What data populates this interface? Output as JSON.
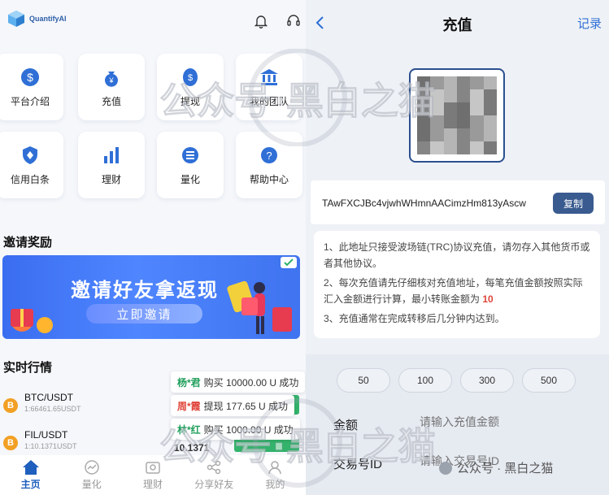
{
  "app": {
    "logo_text": "QuantifyAI"
  },
  "header_icons": [
    "bell-icon",
    "headset-icon"
  ],
  "grid": [
    {
      "label": "平台介绍",
      "icon": "dollar-globe-icon"
    },
    {
      "label": "充值",
      "icon": "money-bag-icon"
    },
    {
      "label": "提现",
      "icon": "coin-icon"
    },
    {
      "label": "我的团队",
      "icon": "bank-icon"
    },
    {
      "label": "信用白条",
      "icon": "shield-icon"
    },
    {
      "label": "理财",
      "icon": "bar-chart-icon"
    },
    {
      "label": "量化",
      "icon": "coin-stack-icon"
    },
    {
      "label": "帮助中心",
      "icon": "help-icon"
    }
  ],
  "invite": {
    "title": "邀请奖励",
    "banner_text": "邀请好友拿返现",
    "button": "立即邀请"
  },
  "market": {
    "title": "实时行情",
    "rows": [
      {
        "pair": "BTC/USDT",
        "volume": "1:66461.65USDT",
        "symbol": "B"
      },
      {
        "pair": "FIL/USDT",
        "volume": "1:10.1371USDT",
        "symbol": "B",
        "price": "10.1371"
      }
    ]
  },
  "toasts": [
    {
      "name": "杨*君",
      "text": "购买 10000.00 U 成功",
      "color": "green"
    },
    {
      "name": "周*霞",
      "text": "提现 177.65 U 成功",
      "color": "red"
    },
    {
      "name": "林*红",
      "text": "购买 1000.00 U 成功",
      "color": "green"
    }
  ],
  "tabs": [
    {
      "label": "主页",
      "icon": "home-icon",
      "active": true
    },
    {
      "label": "量化",
      "icon": "chart-icon",
      "active": false
    },
    {
      "label": "理财",
      "icon": "wallet-icon",
      "active": false
    },
    {
      "label": "分享好友",
      "icon": "share-icon",
      "active": false
    },
    {
      "label": "我的",
      "icon": "user-icon",
      "active": false
    }
  ],
  "recharge": {
    "title": "充值",
    "record": "记录",
    "address": "TAwFXCJBc4vjwhWHmnAACimzHm813yAscw",
    "copy": "复制",
    "notes": {
      "n1": "1、此地址只接受波场链(TRC)协议充值，请勿存入其他货币或者其他协议。",
      "n2_a": "2、每次充值请先仔细核对充值地址，每笔充值金额按照实际汇入金额进行计算，最小转账金额为 ",
      "n2_min": "10",
      "n3": "3、充值通常在完成转移后几分钟内达到。"
    },
    "amount_options": [
      "50",
      "100",
      "300",
      "500"
    ],
    "amount_label": "金额",
    "amount_placeholder": "请输入充值金额",
    "txid_label": "交易号ID",
    "txid_placeholder": "请输入交易号ID"
  },
  "watermark": {
    "text": "公众号 · 黑白之猫",
    "overlay": "公众号·黑白之猫"
  },
  "colors": {
    "primary": "#1f5fbd",
    "button": "#3a5b8f",
    "up": "#33b36b",
    "highlight": "#e0443a"
  }
}
